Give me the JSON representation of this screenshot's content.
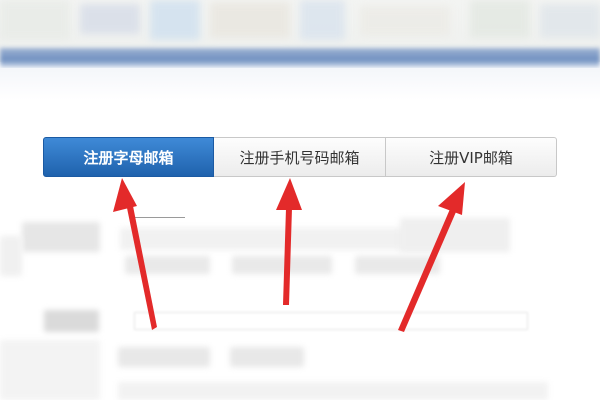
{
  "registration_tabs": [
    {
      "label": "注册字母邮箱",
      "active": true
    },
    {
      "label": "注册手机号码邮箱",
      "active": false
    },
    {
      "label": "注册VIP邮箱",
      "active": false
    }
  ],
  "colors": {
    "active_tab": "#2a72c0",
    "inactive_tab": "#f2f2f2",
    "annotation_arrow": "#e32a2a",
    "header_bar": "#7f9ccb"
  }
}
